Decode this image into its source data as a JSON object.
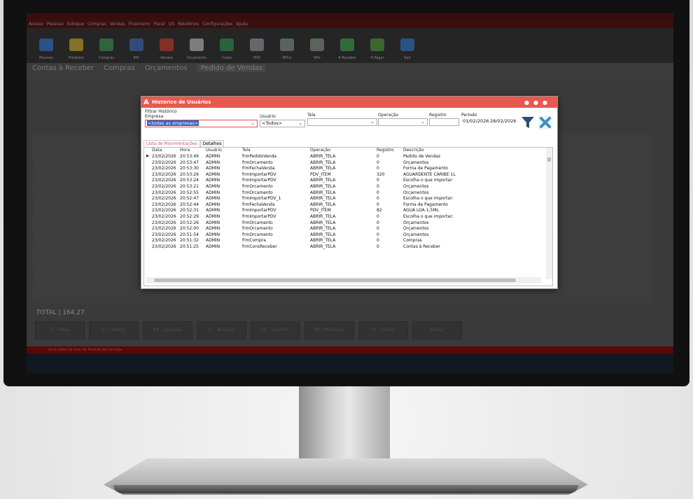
{
  "app": {
    "menu": [
      "Acesso",
      "Pessoas",
      "Estoque",
      "Compras",
      "Vendas",
      "Financeiro",
      "Fiscal",
      "OS",
      "Relatórios",
      "Configurações",
      "Ajuda"
    ],
    "toolbar": [
      "Pessoas",
      "Produtos",
      "Compras",
      "IHC",
      "Vendas",
      "Orçamento",
      "Caixa",
      "PDV",
      "NFCe",
      "NFe",
      "A Receber",
      "A Pagar",
      "Sair"
    ],
    "tabs": [
      "Contas à Receber",
      "Compras",
      "Orçamentos",
      "Pedido de Vendas"
    ],
    "total_label": "TOTAL | 164,27",
    "footer_buttons": [
      "F2 - Novo",
      "F3 - Alterar",
      "F4 - Cancelar",
      "F5 - Atualizar",
      "F6 - Imprimir",
      "F9 - Whatsapp",
      "F8 - Fechar",
      "Fechar"
    ],
    "status_text": "Você esta na tela de Pedido de Vendas"
  },
  "modal": {
    "title": "Histórico de Usuários",
    "filter_section": "Filtrar Histórico",
    "labels": {
      "empresa": "Empresa",
      "usuario": "Usuário",
      "tela": "Tela",
      "operacao": "Operação",
      "registro": "Registro",
      "periodo": "Período"
    },
    "empresa_value": "<todas as empresas>",
    "usuario_value": "<Todos>",
    "tela_value": "",
    "operacao_value": "",
    "registro_value": "",
    "periodo_inicio": "01/02/2026",
    "periodo_fim": "28/02/2026",
    "tabs": [
      "Lista de Movimentações",
      "Detalhes"
    ],
    "columns": [
      "Data",
      "Hora",
      "Usuário",
      "Tela",
      "Operação",
      "Registro",
      "Descrição"
    ],
    "rows": [
      [
        "23/02/2026",
        "20:53:49",
        "ADMIN",
        "frmPedidoVenda",
        "ABRIR_TELA",
        "0",
        "Pedido de Vendas"
      ],
      [
        "23/02/2026",
        "20:53:47",
        "ADMIN",
        "frmOrcamento",
        "ABRIR_TELA",
        "0",
        "Orçamentos"
      ],
      [
        "23/02/2026",
        "20:53:30",
        "ADMIN",
        "frmFechaVenda",
        "ABRIR_TELA",
        "0",
        "Forma de Pagamento"
      ],
      [
        "23/02/2026",
        "20:53:26",
        "ADMIN",
        "frmImportarPDV",
        "PDV_ITEM",
        "320",
        "AGUARDENTE CARIBE 1L"
      ],
      [
        "23/02/2026",
        "20:53:24",
        "ADMIN",
        "frmImportarPDV",
        "ABRIR_TELA",
        "0",
        "Escolha o que importar:"
      ],
      [
        "23/02/2026",
        "20:53:21",
        "ADMIN",
        "frmOrcamento",
        "ABRIR_TELA",
        "0",
        "Orçamentos"
      ],
      [
        "23/02/2026",
        "20:52:55",
        "ADMIN",
        "frmOrcamento",
        "ABRIR_TELA",
        "0",
        "Orçamentos"
      ],
      [
        "23/02/2026",
        "20:52:47",
        "ADMIN",
        "frmImportarPDV_1",
        "ABRIR_TELA",
        "0",
        "Escolha o que importar:"
      ],
      [
        "23/02/2026",
        "20:52:44",
        "ADMIN",
        "frmFechaVenda",
        "ABRIR_TELA",
        "0",
        "Forma de Pagamento"
      ],
      [
        "23/02/2026",
        "20:52:31",
        "ADMIN",
        "frmImportarPDV",
        "PDV_ITEM",
        "82",
        "AGUA LOA 1,5ML"
      ],
      [
        "23/02/2026",
        "20:52:29",
        "ADMIN",
        "frmImportarPDV",
        "ABRIR_TELA",
        "0",
        "Escolha o que importar:"
      ],
      [
        "23/02/2026",
        "20:52:26",
        "ADMIN",
        "frmOrcamento",
        "ABRIR_TELA",
        "0",
        "Orçamentos"
      ],
      [
        "23/02/2026",
        "20:52:00",
        "ADMIN",
        "frmOrcamento",
        "ABRIR_TELA",
        "0",
        "Orçamentos"
      ],
      [
        "23/02/2026",
        "20:51:54",
        "ADMIN",
        "frmOrcamento",
        "ABRIR_TELA",
        "0",
        "Orçamentos"
      ],
      [
        "23/02/2026",
        "20:51:32",
        "ADMIN",
        "frmCompra",
        "ABRIR_TELA",
        "0",
        "Compras"
      ],
      [
        "23/02/2026",
        "20:51:25",
        "ADMIN",
        "frmConsReceber",
        "ABRIR_TELA",
        "0",
        "Contas à Receber"
      ]
    ]
  },
  "colors": {
    "accent": "#e8584f",
    "statusbar": "#8b0b0b"
  }
}
